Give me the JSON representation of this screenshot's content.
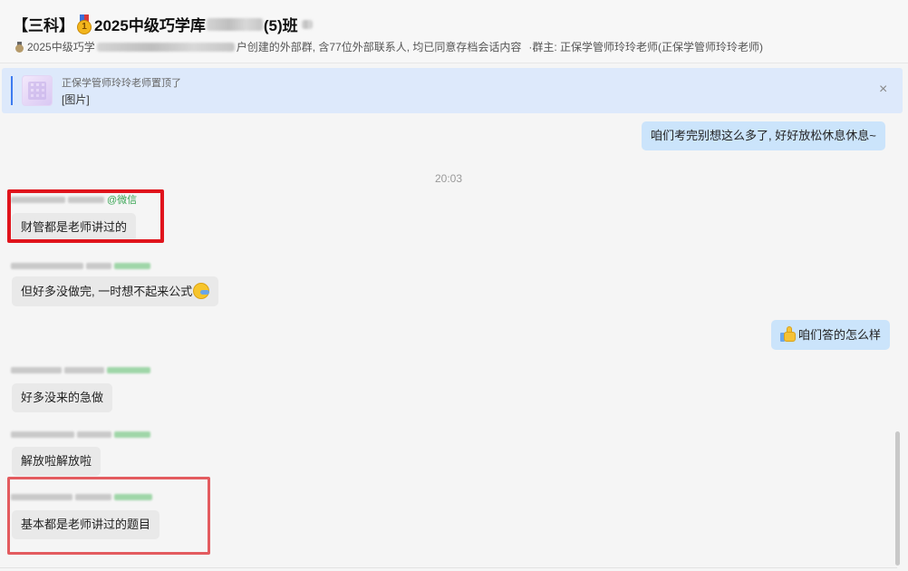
{
  "header": {
    "title_prefix": "【三科】",
    "title_year": "2025中级巧学库",
    "title_suffix": "(5)班",
    "sub_lead": "2025中级巧学",
    "sub_middle": "户创建的外部群, 含77位外部联系人, 均已同意存档会话内容",
    "sub_owner": "·群主: 正保学管师玲玲老师(正保学管师玲玲老师)"
  },
  "pinned": {
    "who": "正保学管师玲玲老师置顶了",
    "content": "[图片]",
    "close_label": "×"
  },
  "messages": {
    "m1": "咱们考完别想这么多了, 好好放松休息休息~",
    "time": "20:03",
    "m2_wechat": "@微信",
    "m2": "财管都是老师讲过的",
    "m3": "但好多没做完, 一时想不起来公式",
    "m4": "咱们答的怎么样",
    "m5_wechat": "@微信",
    "m5": "好多没来的急做",
    "m6": "解放啦解放啦",
    "m7": "基本都是老师讲过的题目"
  }
}
